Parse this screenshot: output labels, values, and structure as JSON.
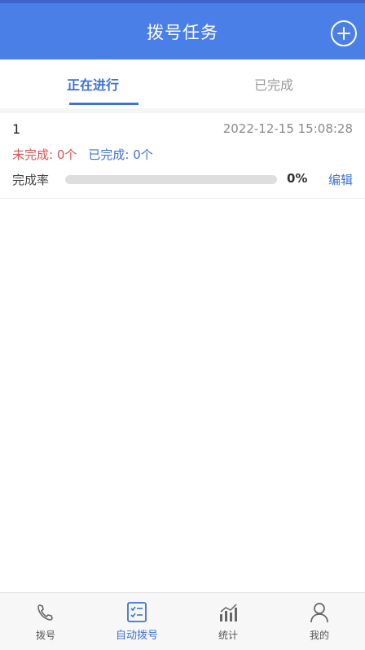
{
  "header": {
    "title": "拨号任务",
    "add_icon": "plus-circle-icon"
  },
  "colors": {
    "brand": "#4b7fe8",
    "accent": "#3e72d6",
    "pending": "#d9534f"
  },
  "tabs": [
    {
      "label": "正在进行",
      "active": true
    },
    {
      "label": "已完成",
      "active": false
    }
  ],
  "tasks": [
    {
      "name": "1",
      "time": "2022-12-15 15:08:28",
      "pending_label": "未完成: ",
      "pending_count": "0个",
      "done_label": "已完成: ",
      "done_count": "0个",
      "progress_label": "完成率",
      "progress_value": 0,
      "progress_text": "0%",
      "edit_label": "编辑"
    }
  ],
  "bottom_nav": [
    {
      "label": "拨号",
      "icon": "phone-icon",
      "active": false
    },
    {
      "label": "自动拨号",
      "icon": "checklist-icon",
      "active": true
    },
    {
      "label": "统计",
      "icon": "bar-chart-icon",
      "active": false
    },
    {
      "label": "我的",
      "icon": "user-icon",
      "active": false
    }
  ]
}
